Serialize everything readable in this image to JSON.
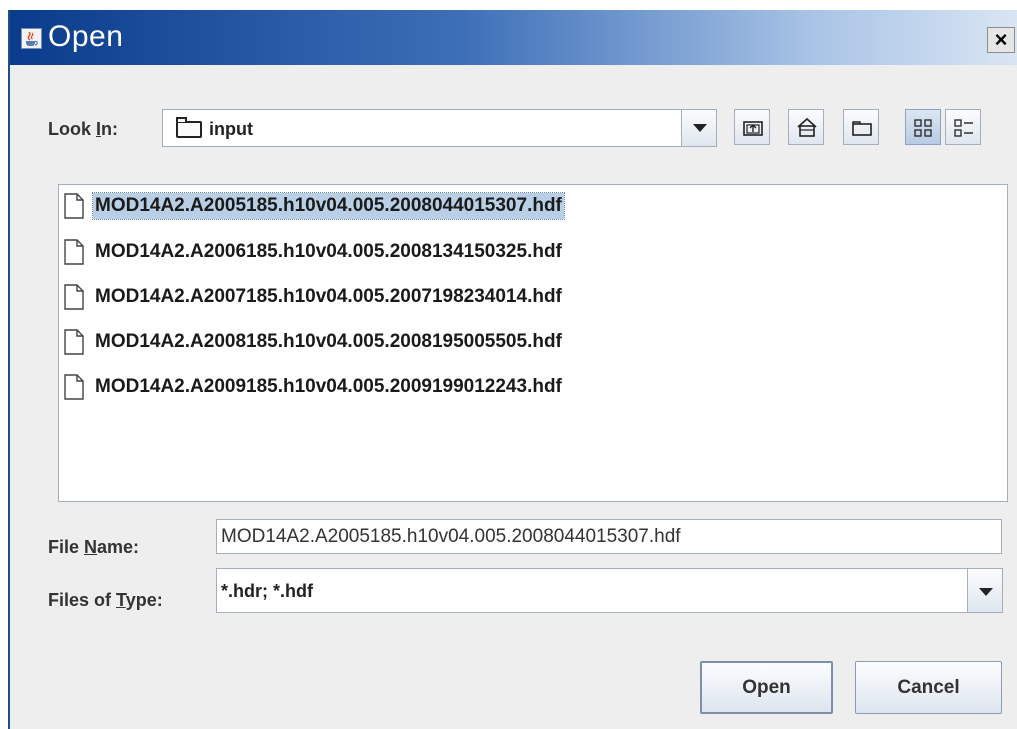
{
  "window": {
    "title": "Open",
    "close_label": "×"
  },
  "look_in": {
    "label_pre": "Look ",
    "label_mnemonic": "I",
    "label_post": "n:",
    "value": "input"
  },
  "toolbar": {
    "buttons": [
      {
        "icon": "up-one-level-icon"
      },
      {
        "icon": "home-icon"
      },
      {
        "icon": "new-folder-icon"
      },
      {
        "icon": "list-view-icon",
        "active": true
      },
      {
        "icon": "details-view-icon"
      }
    ]
  },
  "files": [
    {
      "name": "MOD14A2.A2005185.h10v04.005.2008044015307.hdf",
      "selected": true
    },
    {
      "name": "MOD14A2.A2006185.h10v04.005.2008134150325.hdf"
    },
    {
      "name": "MOD14A2.A2007185.h10v04.005.2007198234014.hdf"
    },
    {
      "name": "MOD14A2.A2008185.h10v04.005.2008195005505.hdf"
    },
    {
      "name": "MOD14A2.A2009185.h10v04.005.2009199012243.hdf"
    }
  ],
  "file_name": {
    "label_pre": "File ",
    "label_mnemonic": "N",
    "label_post": "ame:",
    "value": "MOD14A2.A2005185.h10v04.005.2008044015307.hdf"
  },
  "files_of_type": {
    "label_pre": "Files of ",
    "label_mnemonic": "T",
    "label_post": "ype:",
    "value": "*.hdr; *.hdf"
  },
  "buttons": {
    "open": "Open",
    "cancel": "Cancel"
  }
}
